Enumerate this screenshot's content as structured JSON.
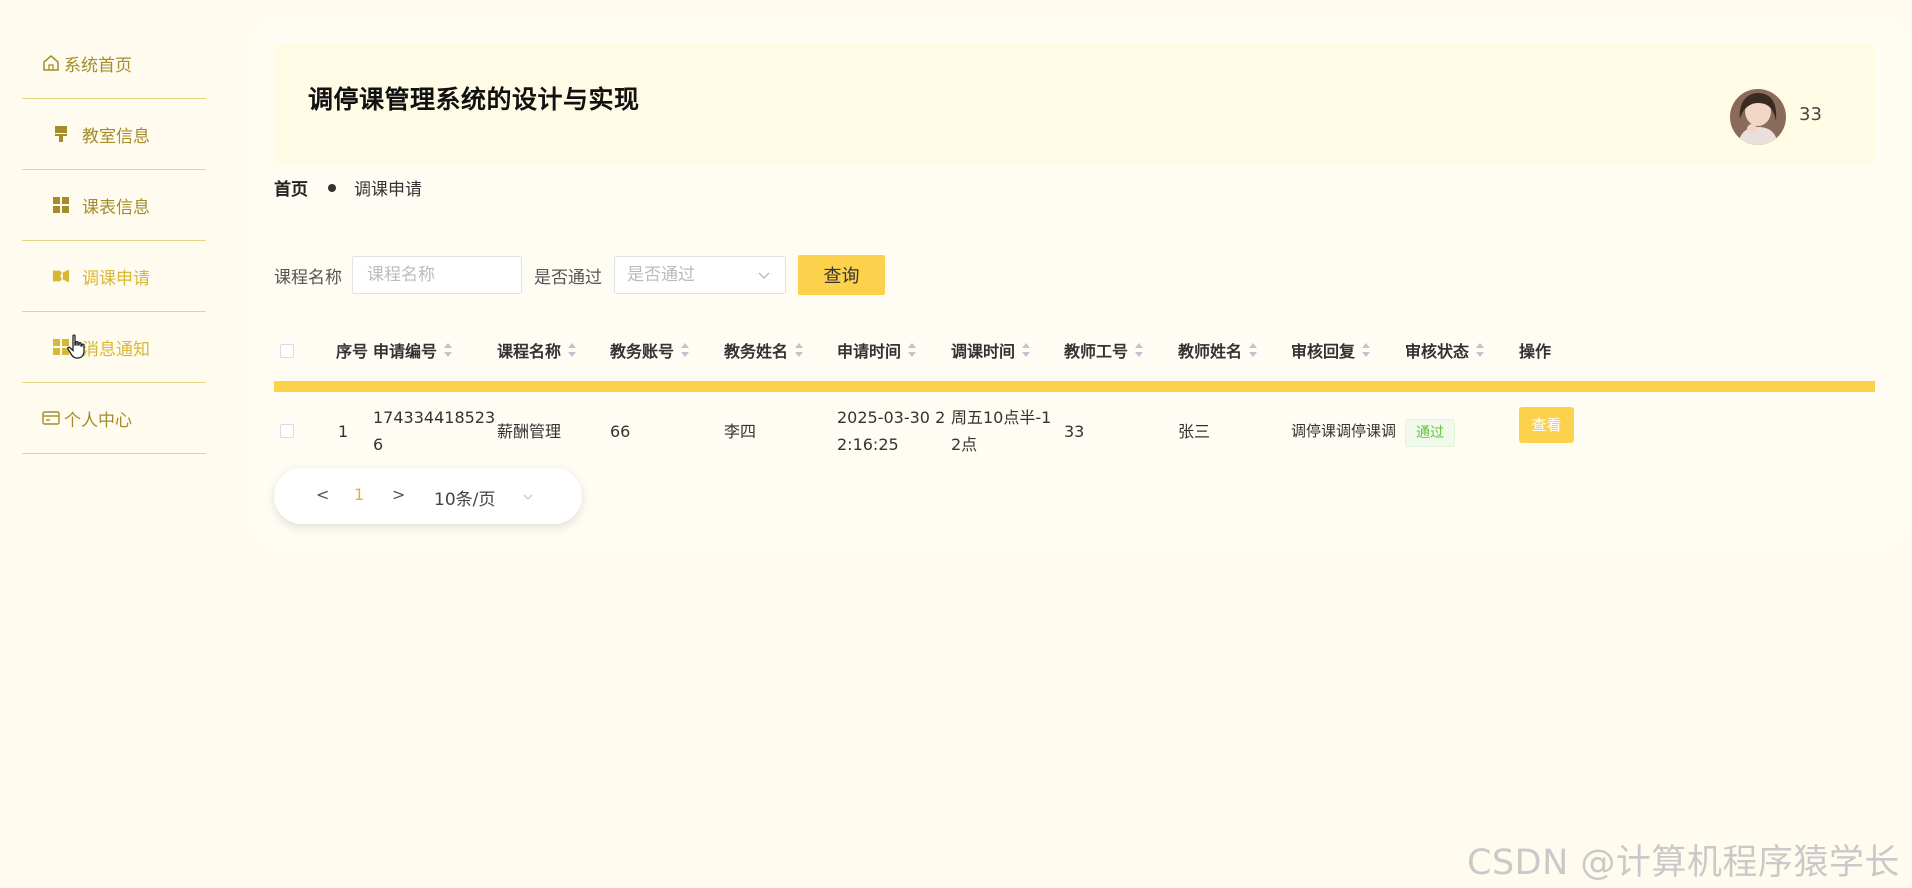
{
  "sidebar": {
    "items": [
      {
        "label": "系统首页",
        "icon": "home-icon"
      },
      {
        "label": "教室信息",
        "icon": "brush-icon"
      },
      {
        "label": "课表信息",
        "icon": "grid-icon"
      },
      {
        "label": "调课申请",
        "icon": "ticket-icon",
        "active": true
      },
      {
        "label": "消息通知",
        "icon": "grid-icon"
      },
      {
        "label": "个人中心",
        "icon": "card-icon"
      }
    ]
  },
  "header": {
    "title": "调停课管理系统的设计与实现",
    "username": "33"
  },
  "breadcrumb": {
    "home": "首页",
    "current": "调课申请"
  },
  "search": {
    "course_label": "课程名称",
    "course_placeholder": "课程名称",
    "pass_label": "是否通过",
    "pass_placeholder": "是否通过",
    "query_button": "查询"
  },
  "table": {
    "columns": [
      "序号",
      "申请编号",
      "课程名称",
      "教务账号",
      "教务姓名",
      "申请时间",
      "调课时间",
      "教师工号",
      "教师姓名",
      "审核回复",
      "审核状态",
      "操作"
    ],
    "rows": [
      {
        "index": "1",
        "apply_no_l1": "174334418523",
        "apply_no_l2": "6",
        "course": "薪酬管理",
        "account": "66",
        "admin_name": "李四",
        "apply_time_l1": "2025-03-30 2",
        "apply_time_l2": "2:16:25",
        "adjust_time_l1": "周五10点半-1",
        "adjust_time_l2": "2点",
        "teacher_no": "33",
        "teacher_name": "张三",
        "reply": "调停课调停课调",
        "status": "通过",
        "action": "查看"
      }
    ]
  },
  "pagination": {
    "prev": "<",
    "page": "1",
    "next": ">",
    "page_size": "10条/页"
  },
  "watermark": "CSDN @计算机程序猿学长",
  "colors": {
    "accent": "#fcd24d",
    "background": "#fffcef",
    "nav_text": "#a48c2c",
    "status_green": "#67c23a"
  }
}
